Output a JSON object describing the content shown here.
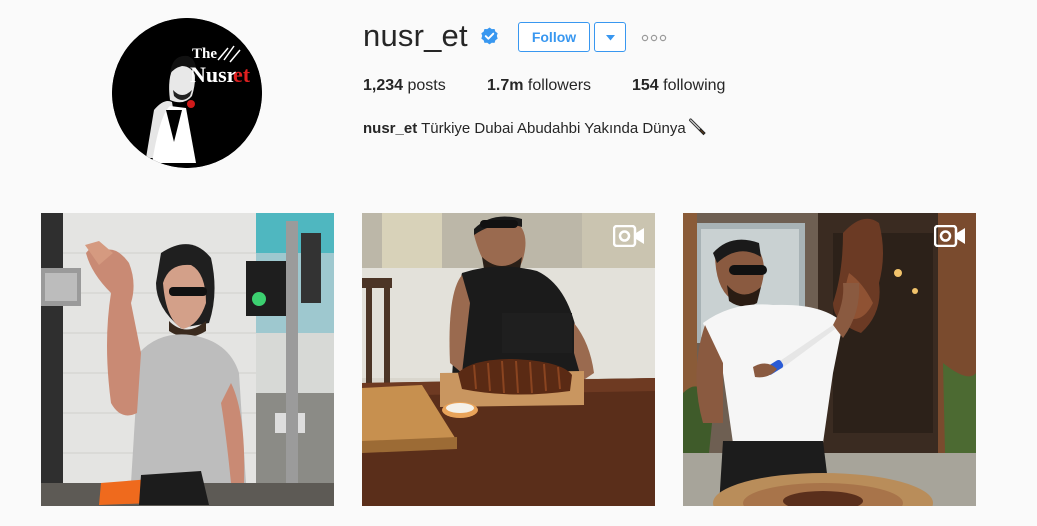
{
  "profile": {
    "username": "nusr_et",
    "verified": true,
    "avatar_text": [
      "The",
      "Nusr",
      "et"
    ],
    "follow_label": "Follow",
    "stats": {
      "posts_count": "1,234",
      "posts_label": "posts",
      "followers_count": "1.7m",
      "followers_label": "followers",
      "following_count": "154",
      "following_label": "following"
    },
    "bio": {
      "name": "nusr_et",
      "text": "Türkiye Dubai Abudahbi Yakında Dünya"
    }
  },
  "icons": {
    "verified": "verified-badge-icon",
    "dropdown": "chevron-down-icon",
    "more": "more-options-icon",
    "video": "video-camera-icon",
    "bio_emoji": "knife-icon"
  },
  "colors": {
    "accent": "#3897f0",
    "background": "#fafafa",
    "text": "#262626"
  },
  "posts": [
    {
      "kind": "image",
      "has_video_icon": false
    },
    {
      "kind": "video",
      "has_video_icon": true
    },
    {
      "kind": "video",
      "has_video_icon": true
    }
  ]
}
